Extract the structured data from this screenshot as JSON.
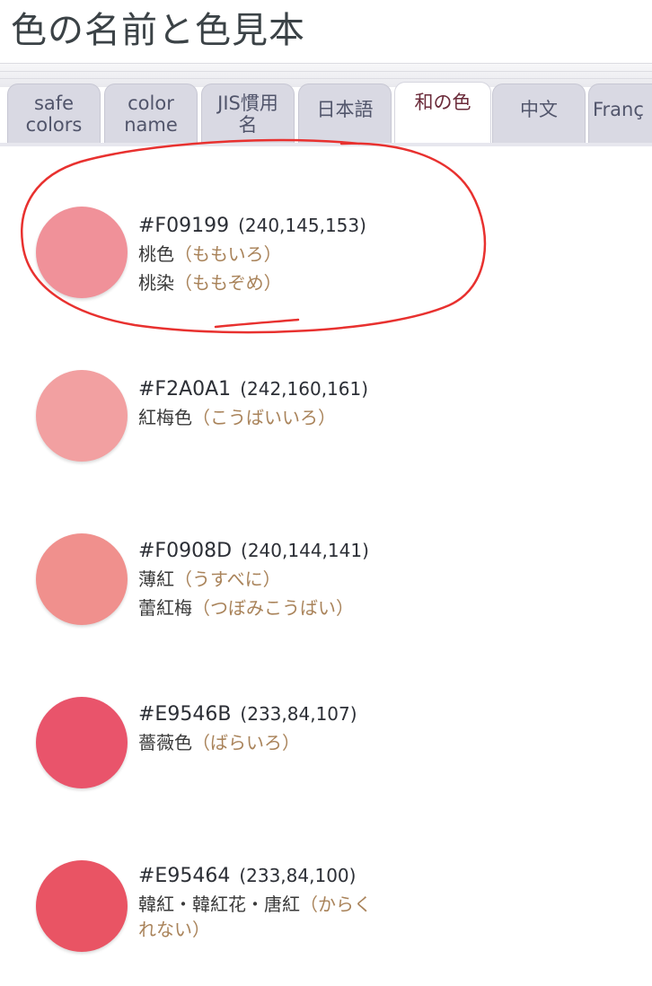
{
  "page_title": "色の名前と色見本",
  "tabs": [
    {
      "label": "safe\ncolors",
      "active": false
    },
    {
      "label": "color\nname",
      "active": false
    },
    {
      "label": "JIS慣用\n名",
      "active": false
    },
    {
      "label": "日本語",
      "active": false
    },
    {
      "label": "和の色",
      "active": true
    },
    {
      "label": "中文",
      "active": false
    },
    {
      "label": "Franç",
      "active": false
    }
  ],
  "colors": [
    {
      "hex": "#F09199",
      "rgb": "(240,145,153)",
      "names": [
        {
          "name": "桃色",
          "reading": "（ももいろ）"
        },
        {
          "name": "桃染",
          "reading": "（ももぞめ）"
        }
      ]
    },
    {
      "hex": "#F2A0A1",
      "rgb": "(242,160,161)",
      "names": [
        {
          "name": "紅梅色",
          "reading": "（こうばいいろ）"
        }
      ]
    },
    {
      "hex": "#F0908D",
      "rgb": "(240,144,141)",
      "names": [
        {
          "name": "薄紅",
          "reading": "（うすべに）"
        },
        {
          "name": "蕾紅梅",
          "reading": "（つぼみこうばい）"
        }
      ]
    },
    {
      "hex": "#E9546B",
      "rgb": "(233,84,107)",
      "names": [
        {
          "name": "薔薇色",
          "reading": "（ばらいろ）"
        }
      ]
    },
    {
      "hex": "#E95464",
      "rgb": "(233,84,100)",
      "names": [
        {
          "name": "韓紅・韓紅花・唐紅",
          "reading": "（からく"
        },
        {
          "name": "",
          "reading": "れない）"
        }
      ]
    }
  ],
  "annotation_color": "#e8312f"
}
